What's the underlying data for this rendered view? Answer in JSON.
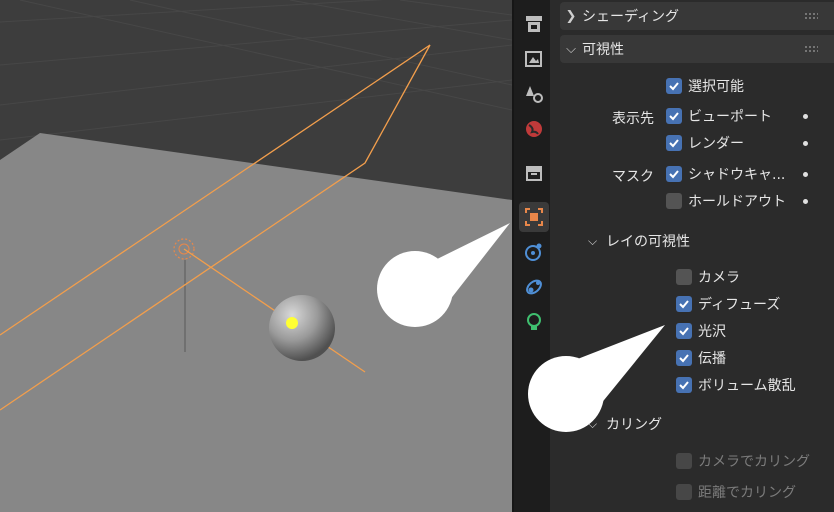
{
  "panel": {
    "shading_title": "シェーディング",
    "visibility_title": "可視性",
    "selectable": {
      "label": "選択可能",
      "checked": true
    },
    "show_in_label": "表示先",
    "viewport": {
      "label": "ビューポート",
      "checked": true
    },
    "render": {
      "label": "レンダー",
      "checked": true
    },
    "mask_label": "マスク",
    "shadow_catcher": {
      "label": "シャドウキャ...",
      "checked": true
    },
    "holdout": {
      "label": "ホールドアウト",
      "checked": false
    },
    "ray_visibility_title": "レイの可視性",
    "ray": [
      {
        "label": "カメラ",
        "checked": false
      },
      {
        "label": "ディフューズ",
        "checked": true
      },
      {
        "label": "光沢",
        "checked": true
      },
      {
        "label": "伝播",
        "checked": true
      },
      {
        "label": "ボリューム散乱",
        "checked": true
      }
    ],
    "culling_title": "カリング",
    "culling": [
      {
        "label": "カメラでカリング",
        "checked": false
      },
      {
        "label": "距離でカリング",
        "checked": false
      }
    ]
  },
  "tabs": [
    "render-icon",
    "output-icon",
    "view-layer-icon",
    "world-icon",
    "collection-icon",
    "object-icon",
    "physics-icon",
    "constraints-icon",
    "object-data-light-icon"
  ],
  "colors": {
    "accent": "#4772b3",
    "selection": "#f29e4c",
    "active_tab": "#e8874a"
  }
}
